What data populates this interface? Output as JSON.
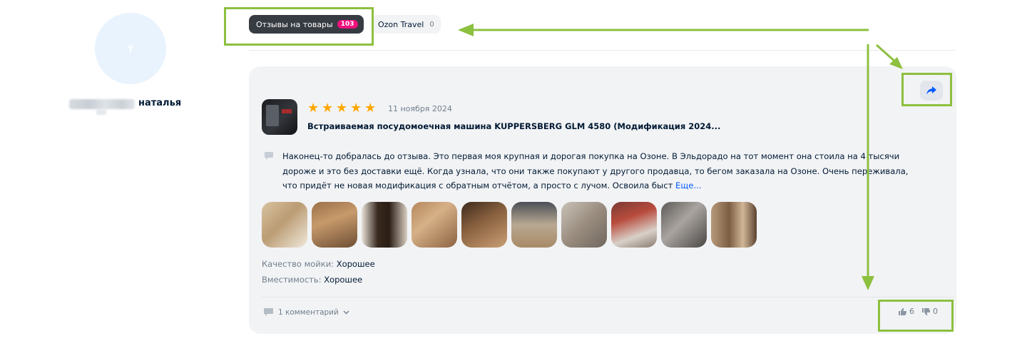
{
  "profile": {
    "avatar_letter": "Y",
    "name": "наталья"
  },
  "tabs": [
    {
      "label": "Отзывы на товары",
      "count": "103",
      "active": true
    },
    {
      "label": "Ozon Travel",
      "count": "0",
      "active": false
    }
  ],
  "review": {
    "rating": 5,
    "date": "11 ноября 2024",
    "product_title": "Встраиваемая посудомоечная машина KUPPERSBERG GLM 4580 (Модификация 2024...",
    "text": "Наконец-то добралась до отзыва. Это первая моя крупная и дорогая покупка на Озоне. В Эльдорадо на тот момент она стоила на 4 тысячи дороже и это без доставки ещё. Когда узнала, что они также покупают у другого продавца, то бегом заказала на Озоне. Очень переживала, что придёт не новая модификация с обратным отчётом, а просто с лучом. Освоила быст",
    "more_label": "Еще...",
    "attributes": [
      {
        "label": "Качество мойки:",
        "value": "Хорошее"
      },
      {
        "label": "Вместимость:",
        "value": "Хорошее"
      }
    ],
    "comments_label": "1 комментарий",
    "likes": "6",
    "dislikes": "0"
  },
  "colors": {
    "accent": "#005bff",
    "star": "#ffa800",
    "badge": "#f1117e",
    "annotation": "#8dc03f"
  }
}
